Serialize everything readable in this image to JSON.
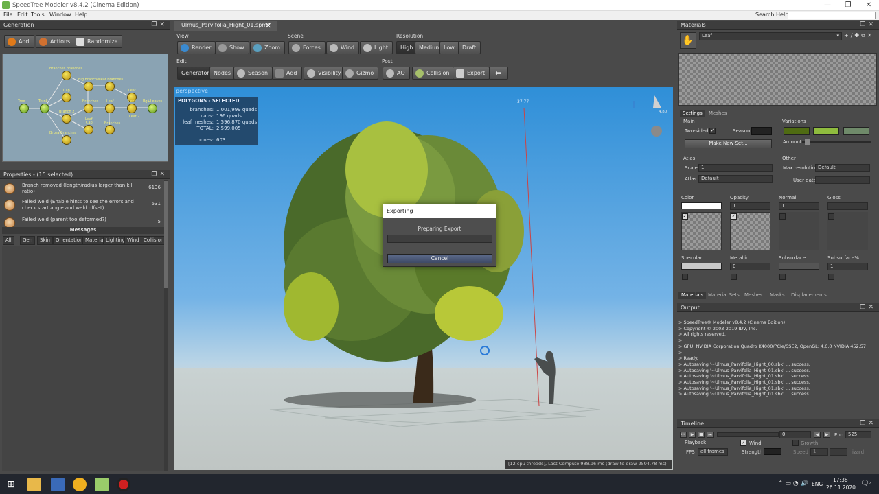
{
  "window": {
    "title": "SpeedTree Modeler v8.4.2 (Cinema Edition)",
    "min": "—",
    "max": "❐",
    "close": "✕"
  },
  "menu": {
    "items": [
      "File",
      "Edit",
      "Tools",
      "Window",
      "Help"
    ],
    "search_label": "Search Help:"
  },
  "generation": {
    "title": "Generation",
    "buttons": {
      "add": "Add",
      "actions": "Actions",
      "randomize": "Randomize"
    },
    "nodes": [
      {
        "label": "Tree",
        "kind": "green"
      },
      {
        "label": "Trunk",
        "kind": "green"
      },
      {
        "label": "Branches branches"
      },
      {
        "label": "Cap"
      },
      {
        "label": "Big Branches"
      },
      {
        "label": "Leaf branches"
      },
      {
        "label": "Leaf"
      },
      {
        "label": "Branch 2"
      },
      {
        "label": "Cap"
      },
      {
        "label": "Branches"
      },
      {
        "label": "Leaf"
      },
      {
        "label": "Branches"
      },
      {
        "label": "Leaf"
      },
      {
        "label": "Leaf 2"
      },
      {
        "label": "Leaf"
      },
      {
        "label": "BrLeafBranches"
      },
      {
        "label": "Bg+Leaves",
        "kind": "green"
      }
    ]
  },
  "properties": {
    "title": "Properties - (15 selected)",
    "rows": [
      {
        "text": "Branch removed (length/radius larger than kill ratio)",
        "count": "6136"
      },
      {
        "text": "Failed weld (Enable hints to see the errors and check start angle and weld offset)",
        "count": "531"
      },
      {
        "text": "Failed weld (parent too deformed?)",
        "count": "5"
      }
    ],
    "messages_label": "Messages",
    "tabs": [
      "All",
      "Gen",
      "Skin",
      "Orientation",
      "Material",
      "Lighting",
      "Wind",
      "Collision"
    ]
  },
  "document": {
    "tab": "Ulmus_Parvifolia_Hight_01.spm*",
    "close": "✕"
  },
  "toolbar": {
    "view_label": "View",
    "view": [
      "Render",
      "Show",
      "Zoom"
    ],
    "scene_label": "Scene",
    "scene": [
      "Forces",
      "Wind",
      "Light"
    ],
    "resolution_label": "Resolution",
    "resolution": [
      "High",
      "Medium",
      "Low",
      "Draft"
    ],
    "resolution_selected": "High",
    "edit_label": "Edit",
    "edit": [
      "Generators",
      "Nodes",
      "Season",
      "Add",
      "Visibility",
      "Gizmo"
    ],
    "post_label": "Post",
    "post": [
      "AO",
      "Collision",
      "Export"
    ]
  },
  "viewport": {
    "mode": "perspective",
    "polygons": {
      "header": "POLYGONS - SELECTED",
      "rows": [
        {
          "k": "branches:",
          "v": "1,001,999 quads"
        },
        {
          "k": "caps:",
          "v": "136 quads"
        },
        {
          "k": "leaf meshes:",
          "v": "1,596,870 quads"
        },
        {
          "k": "TOTAL:",
          "v": "2,599,005"
        },
        {
          "k": "bones:",
          "v": "603"
        }
      ]
    },
    "height_marker": "37.77",
    "light_value": "4.80",
    "status": "[12 cpu threads], Last Compute 988.96 ms (draw to draw 2594.78 ms)"
  },
  "export_dialog": {
    "title": "Exporting",
    "message": "Preparing Export",
    "cancel": "Cancel"
  },
  "materials": {
    "title": "Materials",
    "selected": "Leaf",
    "tabs": [
      "Settings",
      "Meshes"
    ],
    "main_label": "Main",
    "two_sided": "Two-sided",
    "season": "Season",
    "variations_label": "Variations",
    "amount": "Amount",
    "make_new_set": "Make New Set...",
    "atlas_label": "Atlas",
    "scale_label": "Scale",
    "scale_value": "1",
    "atlas_field_label": "Atlas",
    "atlas_value": "Default",
    "other_label": "Other",
    "max_res_label": "Max resolution",
    "max_res_value": "Default",
    "user_data_label": "User data",
    "maps": [
      {
        "label": "Color",
        "value": ""
      },
      {
        "label": "Opacity",
        "value": "1"
      },
      {
        "label": "Normal",
        "value": "1"
      },
      {
        "label": "Gloss",
        "value": "1"
      },
      {
        "label": "Specular",
        "value": ""
      },
      {
        "label": "Metallic",
        "value": "0"
      },
      {
        "label": "Subsurface",
        "value": ""
      },
      {
        "label": "Subsurface%",
        "value": "1"
      }
    ],
    "bottom_tabs": [
      "Materials",
      "Material Sets",
      "Meshes",
      "Masks",
      "Displacements"
    ],
    "colors": {
      "var1": "#4f6b12",
      "var2": "#8fbc3e",
      "var3": "#6f8a6a"
    }
  },
  "output": {
    "title": "Output",
    "lines": [
      "> SpeedTree® Modeler v8.4.2 (Cinema Edition)",
      "> Copyright © 2003-2019 IDV, Inc.",
      "> All rights reserved.",
      ">",
      "> GPU: NVIDIA Corporation Quadro K4000/PCIe/SSE2, OpenGL: 4.6.0 NVIDIA 452.57",
      ">",
      "> Ready.",
      "> Autosaving '~Ulmus_Parvifolia_Hight_00.sbk' ... success.",
      "> Autosaving '~Ulmus_Parvifolia_Hight_01.sbk' ... success.",
      "> Autosaving '~Ulmus_Parvifolia_Hight_01.sbk' ... success.",
      "> Autosaving '~Ulmus_Parvifolia_Hight_01.sbk' ... success.",
      "> Autosaving '~Ulmus_Parvifolia_Hight_01.sbk' ... success.",
      "> Autosaving '~Ulmus_Parvifolia_Hight_01.sbk' ... success."
    ]
  },
  "timeline": {
    "title": "Timeline",
    "frame": "0",
    "end_label": "End",
    "end_value": "525",
    "playback": "Playback",
    "fps_label": "FPS",
    "fps_value": "all frames",
    "wind": "Wind",
    "growth": "Growth",
    "strength": "Strength",
    "speed": "Speed",
    "speed_value": "1",
    "wizard": "izard"
  },
  "taskbar": {
    "lang": "ENG",
    "time": "17:38",
    "date": "26.11.2020",
    "notif": "4"
  }
}
